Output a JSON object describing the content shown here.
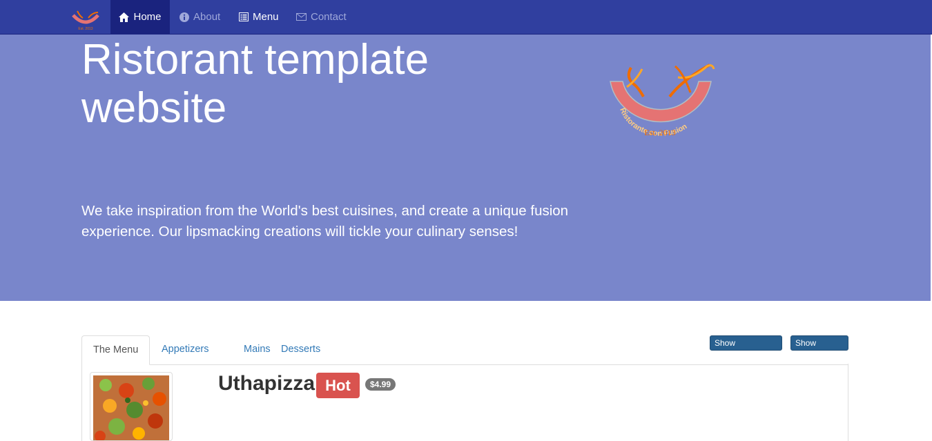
{
  "navbar": {
    "brand_logo_text": "Est. 2013",
    "items": [
      {
        "label": "Home",
        "icon": "home-icon",
        "active": true
      },
      {
        "label": "About",
        "icon": "info-icon",
        "active": false
      },
      {
        "label": "Menu",
        "icon": "list-icon",
        "active": false
      },
      {
        "label": "Contact",
        "icon": "envelope-icon",
        "active": false
      }
    ]
  },
  "jumbotron": {
    "title": "Ristorant template website",
    "text": "We take inspiration from the World's best cuisines, and create a unique fusion experience. Our lipsmacking creations will tickle your culinary senses!",
    "logo_arc_text": "Ristorante con Fusion",
    "logo_est_text": "Est. 2013"
  },
  "menu_tabs": [
    "The Menu",
    "Appetizers",
    "Mains",
    "Desserts"
  ],
  "buttons": {
    "show_comments": "Show Comments",
    "show_details": "Show Details"
  },
  "dish": {
    "name": "Uthapizza",
    "badge": "Hot",
    "price": "$4.99"
  },
  "colors": {
    "navbar": "#303f9f",
    "navbar_active": "#1a237e",
    "jumbotron": "#7986cb",
    "hot_badge": "#d9534f",
    "button": "#286090"
  }
}
